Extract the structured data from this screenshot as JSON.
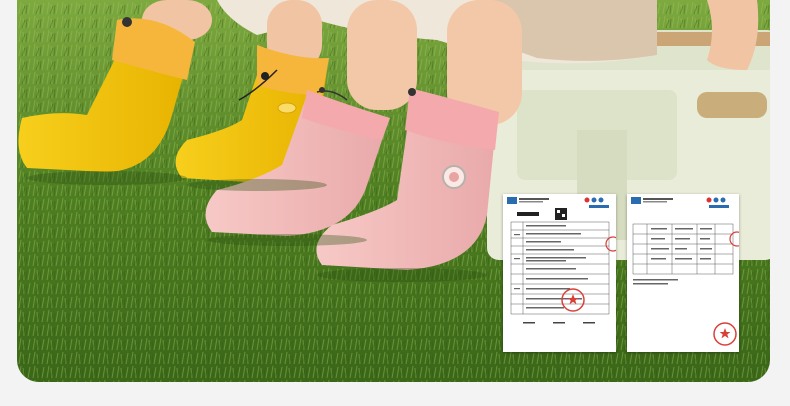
{
  "scene": {
    "description_visible_text": [],
    "colors": {
      "grass": "#4f7f22",
      "grass_light": "#8fb84a",
      "yellow_boot": "#f4c410",
      "pink_boot": "#f2b9b9",
      "skin": "#f2c7a7",
      "bench": "#e7ecd7",
      "background": "#f3f3f3"
    }
  },
  "documents": [
    {
      "id": "report-1",
      "stamp_color": "#d9403a"
    },
    {
      "id": "report-2",
      "stamp_color": "#d9403a"
    }
  ]
}
